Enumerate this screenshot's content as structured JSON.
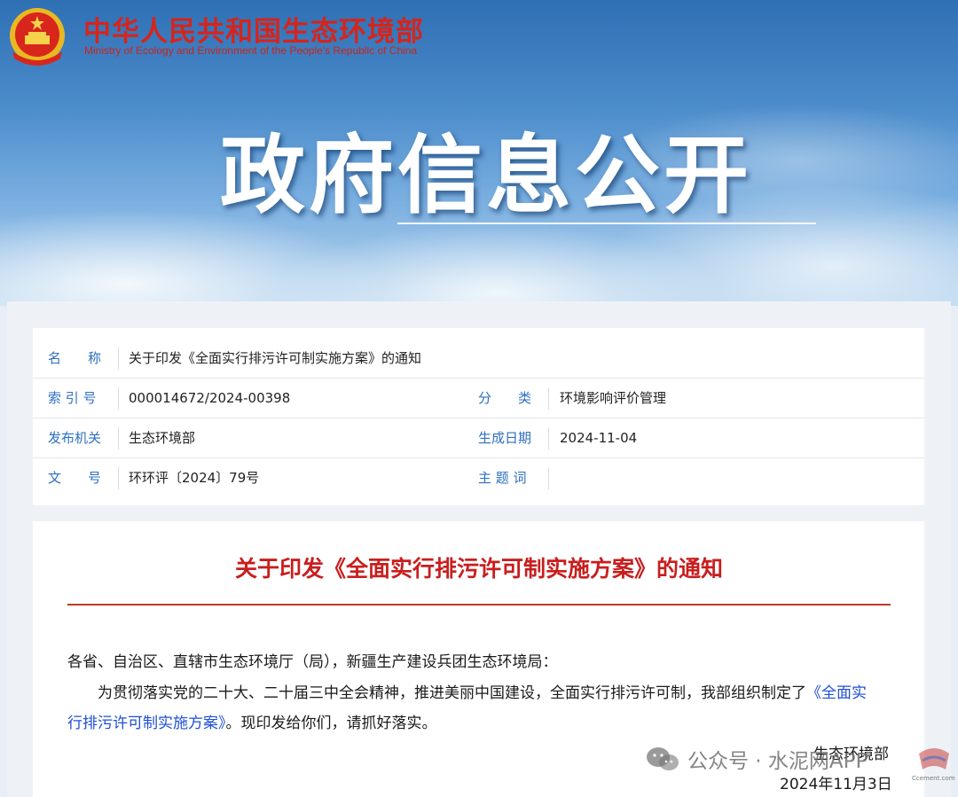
{
  "header": {
    "ministry_cn": "中华人民共和国生态环境部",
    "ministry_en": "Ministry of Ecology and Environment of the People's Republic of China",
    "emblem_icon": "national-emblem-icon",
    "banner_title": "政府信息公开"
  },
  "meta": {
    "name_label": "名　　称",
    "name_value": "关于印发《全面实行排污许可制实施方案》的通知",
    "index_label": "索 引 号",
    "index_value": "000014672/2024-00398",
    "category_label": "分　　类",
    "category_value": "环境影响评价管理",
    "issuer_label": "发布机关",
    "issuer_value": "生态环境部",
    "date_label": "生成日期",
    "date_value": "2024-11-04",
    "doc_no_label": "文　　号",
    "doc_no_value": "环环评〔2024〕79号",
    "keywords_label": "主 题 词",
    "keywords_value": ""
  },
  "document": {
    "title": "关于印发《全面实行排污许可制实施方案》的通知",
    "salutation": "各省、自治区、直辖市生态环境厅（局），新疆生产建设兵团生态环境局：",
    "body_line1_prefix": "为贯彻落实党的二十大、二十届三中全会精神，推进美丽中国建设，全面实行排污许可制，我部组织制定了",
    "body_link_part1": "《全面实",
    "body_link_part2": "行排污许可制实施方案》",
    "body_line2_suffix": "。现印发给你们，请抓好落实。",
    "signature": "生态环境部",
    "signed_date": "2024年11月3日"
  },
  "watermark": {
    "text": "公众号 · 水泥网APP",
    "icon": "wechat-icon",
    "logo_icon": "ccement-logo-icon",
    "logo_text": "Ccement.com"
  },
  "colors": {
    "ministry_red": "#d6241c",
    "label_blue": "#2d6fc0",
    "title_red": "#c81e1e",
    "link_blue": "#1f4fd6"
  }
}
